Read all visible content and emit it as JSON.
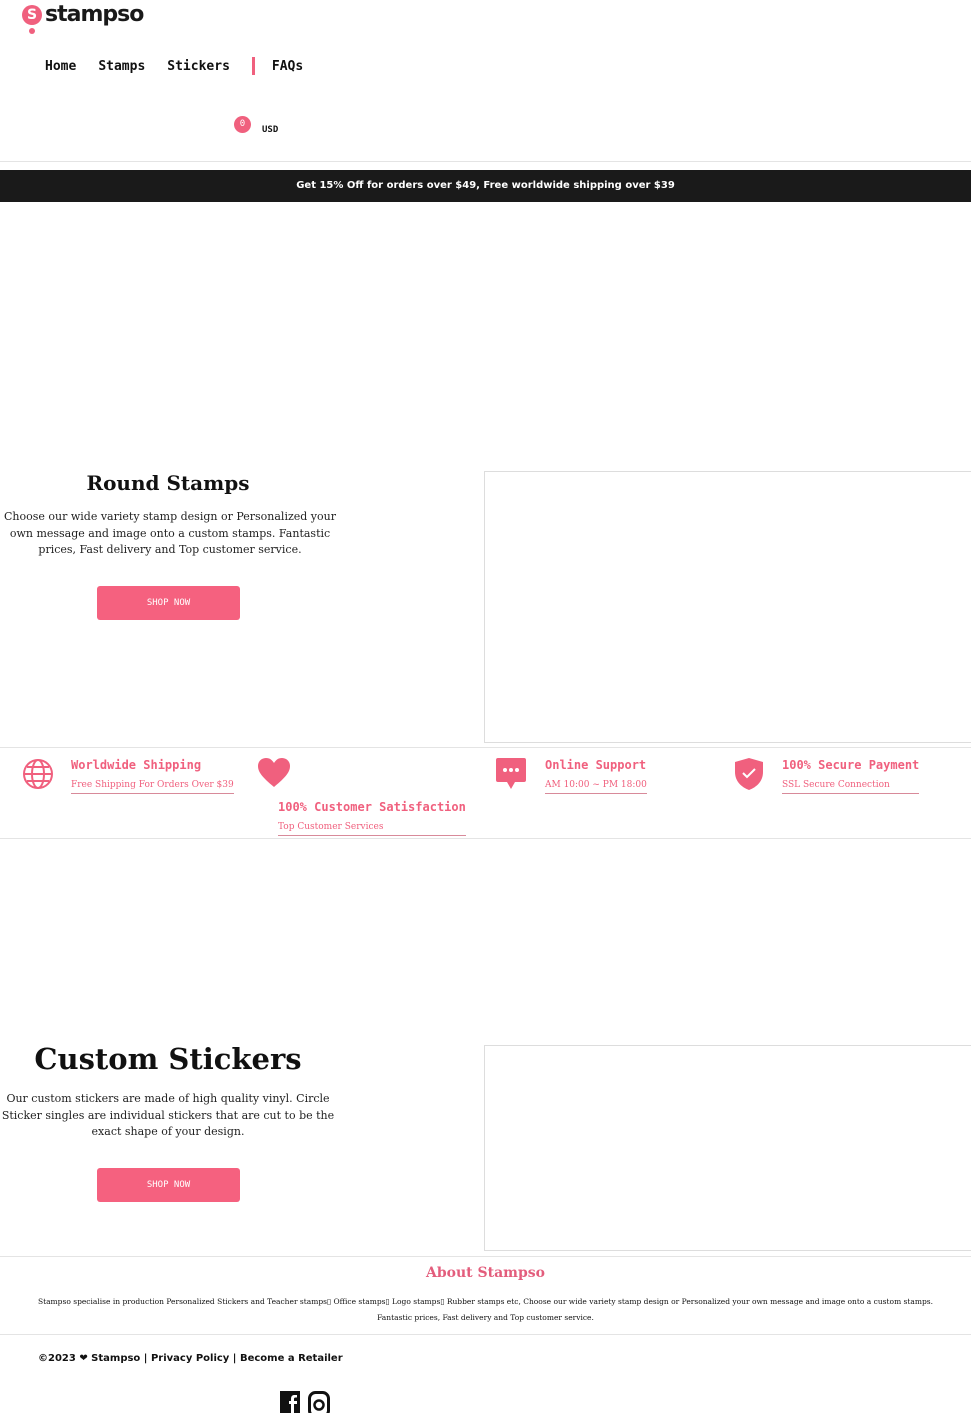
{
  "header": {
    "logo_letter": "S",
    "logo_text": "stampso",
    "nav": [
      "Home",
      "Stamps",
      "Stickers",
      "FAQs"
    ],
    "cart_count": "0",
    "currency": "USD"
  },
  "banner": "Get 15% Off for orders over $49, Free worldwide shipping over $39",
  "round_stamps": {
    "title": "Round Stamps",
    "desc": "Choose our wide variety stamp design or Personalized your own message and image onto a custom stamps. Fantastic prices, Fast delivery and Top customer service.",
    "button": "SHOP NOW"
  },
  "features": [
    {
      "icon": "globe-icon",
      "title": "Worldwide Shipping",
      "sub": "Free Shipping For Orders Over $39"
    },
    {
      "icon": "heart-icon",
      "title": "100% Customer Satisfaction",
      "sub": "Top Customer Services"
    },
    {
      "icon": "chat-icon",
      "title": "Online Support",
      "sub": "AM 10:00 ~ PM 18:00"
    },
    {
      "icon": "shield-check-icon",
      "title": "100% Secure Payment",
      "sub": "SSL Secure Connection"
    }
  ],
  "custom_stickers": {
    "title": "Custom Stickers",
    "desc": "Our custom stickers are made of high quality vinyl. Circle Sticker singles are individual stickers that are cut to be the exact shape of your design.",
    "button": "SHOP NOW"
  },
  "about": {
    "title": "About Stampso",
    "desc": "Stampso specialise in production Personalized Stickers and Teacher stamps▯ Office stamps▯ Logo stamps▯ Rubber stamps etc, Choose our wide variety stamp design or Personalized your own message and image onto a custom stamps. Fantastic prices, Fast delivery and Top customer service."
  },
  "footer": {
    "copyright": "©2023 ❤ Stampso",
    "privacy": "Privacy Policy",
    "retailer": "Become a Retailer",
    "social": [
      "facebook-icon",
      "instagram-icon"
    ]
  },
  "colors": {
    "accent": "#f5617f",
    "banner_bg": "#1a1a1a"
  }
}
